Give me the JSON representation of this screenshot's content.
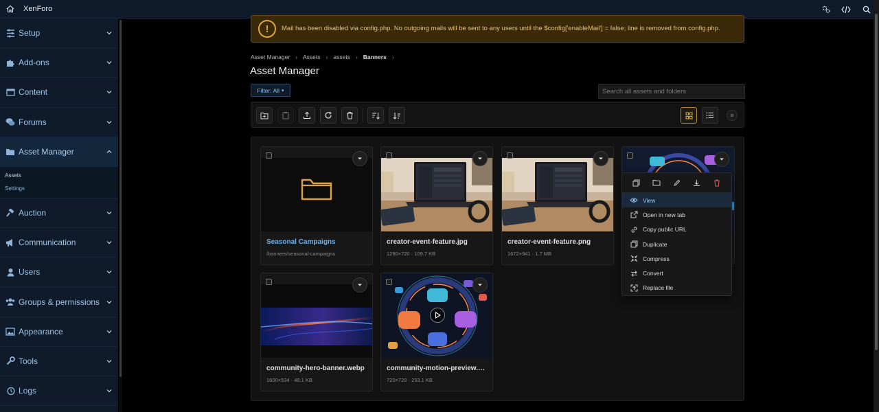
{
  "app": {
    "title": "XenForo"
  },
  "topbar": {
    "icons": [
      "home-icon",
      "settings-gear-icon",
      "code-icon",
      "search-icon"
    ]
  },
  "sidebar": {
    "items": [
      {
        "label": "Setup",
        "icon": "wrench-setup-icon"
      },
      {
        "label": "Add-ons",
        "icon": "puzzle-icon"
      },
      {
        "label": "Content",
        "icon": "window-icon"
      },
      {
        "label": "Forums",
        "icon": "chat-icon"
      },
      {
        "label": "Asset Manager",
        "icon": "folder-icon",
        "expanded": true,
        "children": [
          "Assets",
          "Settings"
        ],
        "selected_child": "Assets"
      },
      {
        "label": "Auction",
        "icon": "gavel-icon"
      },
      {
        "label": "Communication",
        "icon": "megaphone-icon"
      },
      {
        "label": "Users",
        "icon": "user-icon"
      },
      {
        "label": "Groups & permissions",
        "icon": "users-icon"
      },
      {
        "label": "Appearance",
        "icon": "image-icon"
      },
      {
        "label": "Tools",
        "icon": "wrench-icon"
      },
      {
        "label": "Logs",
        "icon": "history-icon"
      }
    ]
  },
  "notice": {
    "text": "Mail has been disabled via config.php. No outgoing mails will be sent to any users until the $config['enableMail'] = false; line is removed from config.php.",
    "color": "#e0a43a"
  },
  "breadcrumb": [
    "Asset Manager",
    "Assets",
    "assets",
    "Banners"
  ],
  "page": {
    "title": "Asset Manager"
  },
  "filter": {
    "label": "Filter: All"
  },
  "search": {
    "placeholder": "Search all assets and folders"
  },
  "toolbar": {
    "buttons": [
      "new-folder-icon",
      "paste-icon",
      "upload-icon",
      "refresh-icon",
      "delete-icon",
      "sort-icon",
      "sort-direction-icon"
    ],
    "view_buttons": [
      "grid-view-icon",
      "list-view-icon",
      "more-icon"
    ],
    "active_view": "grid"
  },
  "assets": [
    {
      "name": "Seasonal Campaigns",
      "meta": "/banners/seasonal-campaigns",
      "type": "folder"
    },
    {
      "name": "creator-event-feature.jpg",
      "meta": "1280×720 · 109.7 KB",
      "type": "image"
    },
    {
      "name": "creator-event-feature.png",
      "meta": "1672×941 · 1.7 MB",
      "type": "image"
    },
    {
      "name": "community-hero-banner.webp",
      "meta": "1600×534 · 48.1 KB",
      "type": "image"
    },
    {
      "name": "community-motion-preview.m...",
      "meta": "720×720 · 293.1 KB",
      "type": "video"
    }
  ],
  "context_menu": {
    "quick_actions": [
      "copy-icon",
      "move-folder-icon",
      "rename-pencil-icon",
      "download-icon",
      "trash-icon"
    ],
    "items": [
      {
        "label": "View",
        "icon": "eye-icon",
        "highlighted": true
      },
      {
        "label": "Open in new tab",
        "icon": "external-link-icon"
      },
      {
        "label": "Copy public URL",
        "icon": "link-icon"
      },
      {
        "label": "Duplicate",
        "icon": "duplicate-icon"
      },
      {
        "label": "Compress",
        "icon": "compress-icon"
      },
      {
        "label": "Convert",
        "icon": "convert-icon"
      },
      {
        "label": "Replace file",
        "icon": "replace-icon"
      }
    ]
  },
  "colors": {
    "accent": "#6fb2e8",
    "warning": "#e0a43a",
    "sidebar_bg": "#0f1b2a",
    "active_view_border": "#b8892a"
  }
}
